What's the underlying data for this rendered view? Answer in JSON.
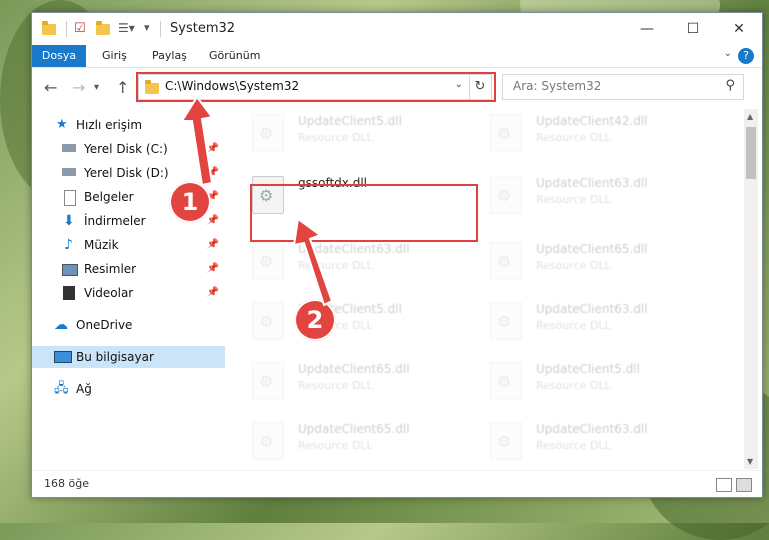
{
  "window": {
    "title": "System32"
  },
  "ribbon": {
    "tabs": [
      "Dosya",
      "Giriş",
      "Paylaş",
      "Görünüm"
    ],
    "help": "?"
  },
  "nav": {
    "address": "C:\\Windows\\System32",
    "search_placeholder": "Ara: System32"
  },
  "sidebar": {
    "items": [
      {
        "label": "Hızlı erişim",
        "icon": "star-icon"
      },
      {
        "label": "Yerel Disk (C:)",
        "icon": "drive-icon"
      },
      {
        "label": "Yerel Disk (D:)",
        "icon": "drive-icon"
      },
      {
        "label": "Belgeler",
        "icon": "document-icon"
      },
      {
        "label": "İndirmeler",
        "icon": "download-icon"
      },
      {
        "label": "Müzik",
        "icon": "music-icon"
      },
      {
        "label": "Resimler",
        "icon": "pictures-icon"
      },
      {
        "label": "Videolar",
        "icon": "video-icon"
      },
      {
        "label": "OneDrive",
        "icon": "cloud-icon"
      },
      {
        "label": "Bu bilgisayar",
        "icon": "computer-icon"
      },
      {
        "label": "Ağ",
        "icon": "network-icon"
      }
    ]
  },
  "files": {
    "highlight": {
      "name": "gssoftdx.dll",
      "type": ""
    },
    "left": [
      {
        "name": "UpdateClient5.dll",
        "type": "Resource DLL"
      },
      {
        "name": "UpdateClient63.dll",
        "type": "Resource DLL"
      },
      {
        "name": "UpdateClient5.dll",
        "type": "Resource DLL"
      },
      {
        "name": "UpdateClient65.dll",
        "type": "Resource DLL"
      },
      {
        "name": "UpdateClient65.dll",
        "type": "Resource DLL"
      }
    ],
    "right": [
      {
        "name": "UpdateClient42.dll",
        "type": "Resource DLL"
      },
      {
        "name": "UpdateClient63.dll",
        "type": "Resource DLL"
      },
      {
        "name": "UpdateClient65.dll",
        "type": "Resource DLL"
      },
      {
        "name": "UpdateClient63.dll",
        "type": "Resource DLL"
      },
      {
        "name": "UpdateClient5.dll",
        "type": "Resource DLL"
      },
      {
        "name": "UpdateClient63.dll",
        "type": "Resource DLL"
      }
    ]
  },
  "status": {
    "count": "168 öğe"
  },
  "annotations": {
    "step1": "1",
    "step2": "2"
  },
  "colors": {
    "accent": "#1979ca",
    "annotation": "#e2453f"
  }
}
